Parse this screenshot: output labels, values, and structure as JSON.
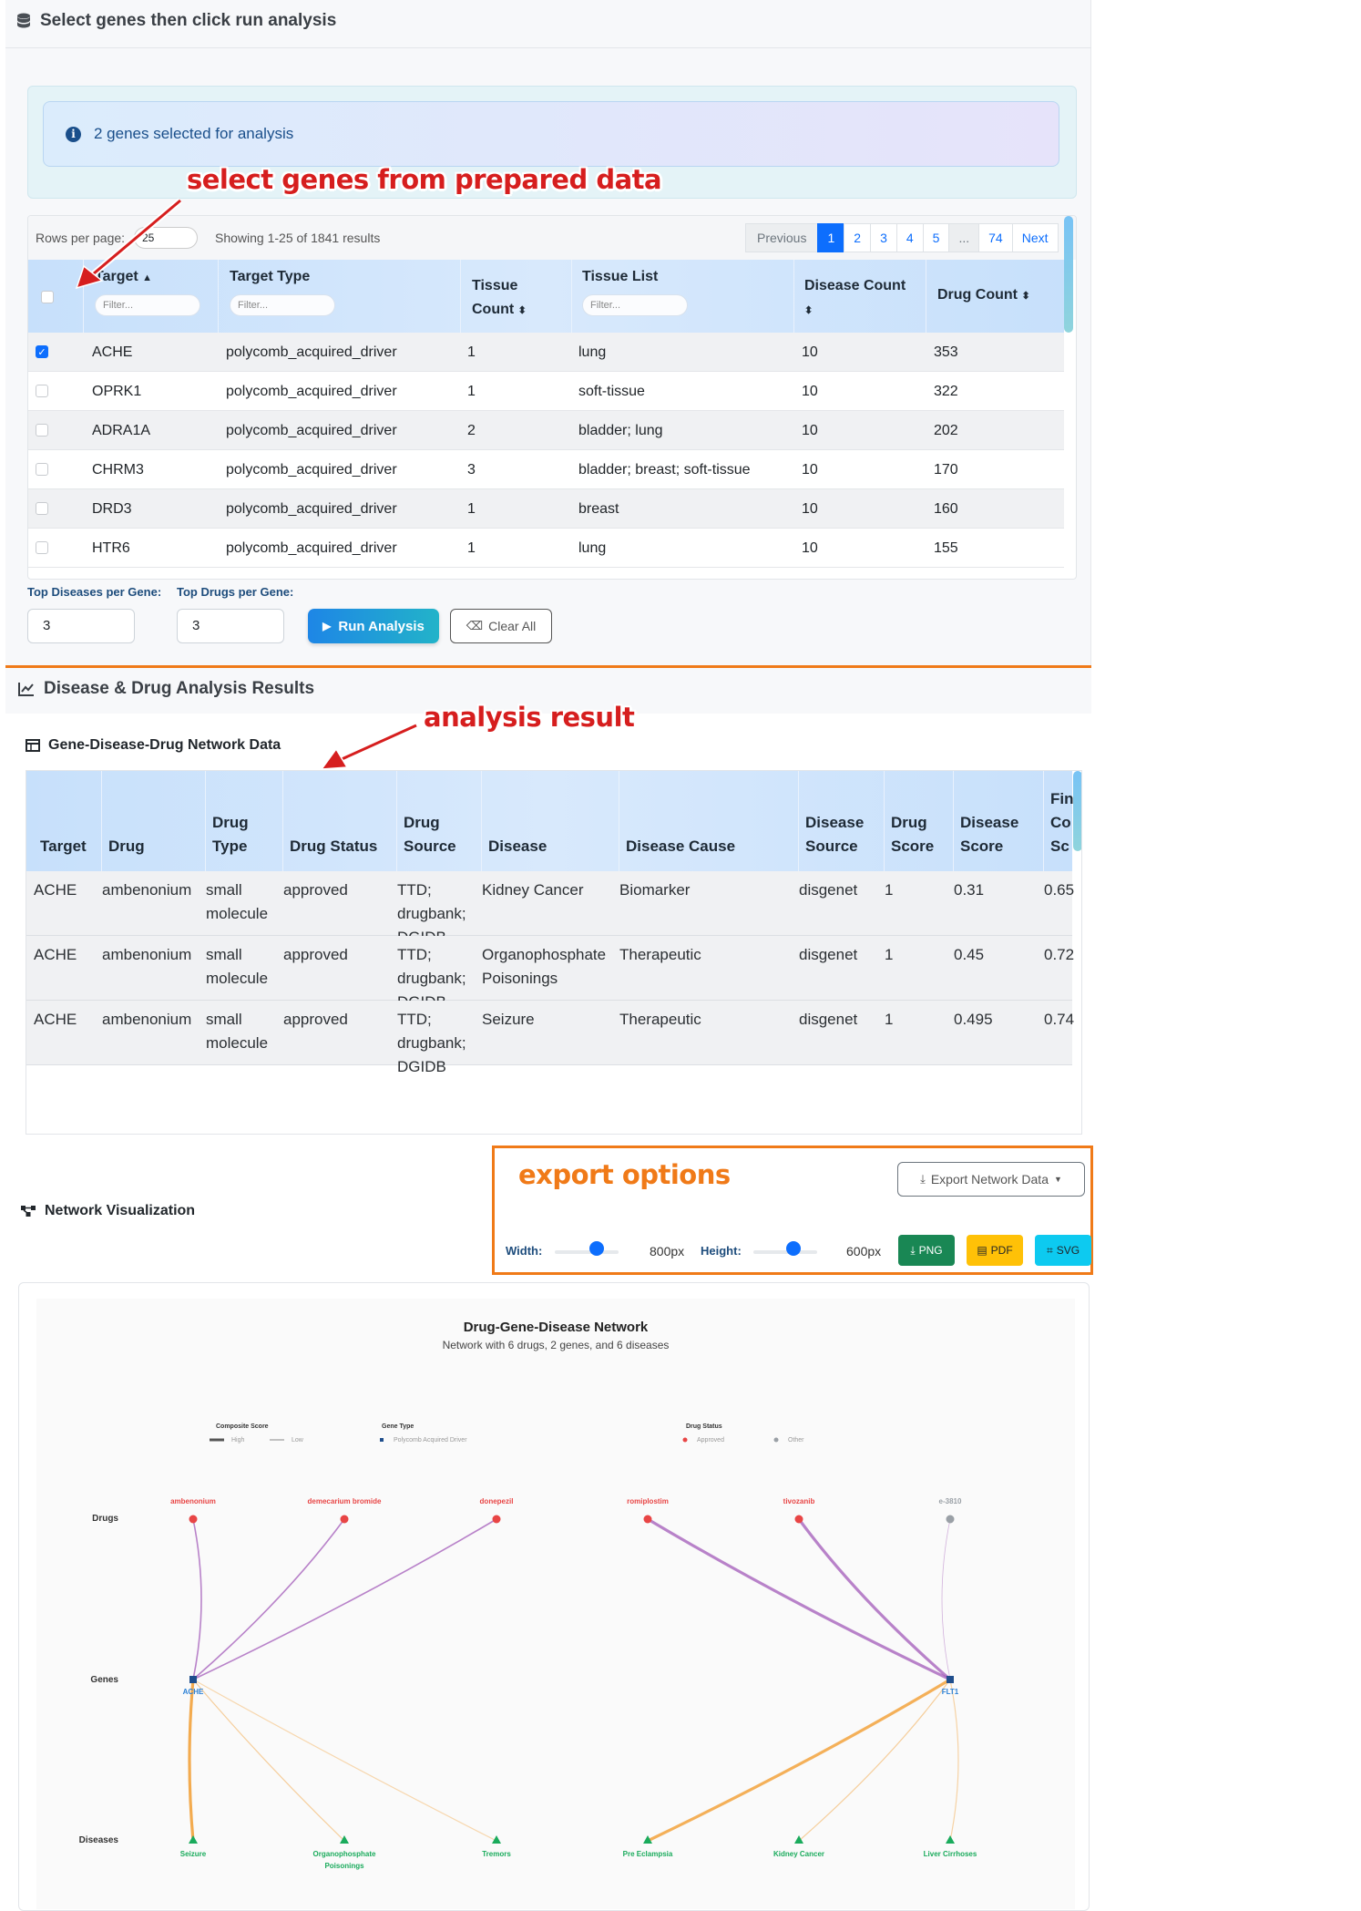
{
  "selection_panel": {
    "title": "Select genes then click run analysis",
    "info_text": "2 genes selected for analysis",
    "annotation": "select genes from prepared data"
  },
  "targets_table": {
    "rows_per_page_label": "Rows per page:",
    "rows_per_page_value": "25",
    "showing_text": "Showing 1-25 of 1841 results",
    "pagination": [
      "Previous",
      "1",
      "2",
      "3",
      "4",
      "5",
      "...",
      "74",
      "Next"
    ],
    "active_page": "1",
    "headers": {
      "target": "Target",
      "target_type": "Target Type",
      "tissue_count_1": "Tissue",
      "tissue_count_2": "Count",
      "tissue_list": "Tissue List",
      "disease_count": "Disease Count",
      "drug_count": "Drug Count"
    },
    "filter_placeholder": "Filter...",
    "rows": [
      {
        "checked": true,
        "target": "ACHE",
        "target_type": "polycomb_acquired_driver",
        "tissue_count": "1",
        "tissue_list": "lung",
        "disease_count": "10",
        "drug_count": "353"
      },
      {
        "checked": false,
        "target": "OPRK1",
        "target_type": "polycomb_acquired_driver",
        "tissue_count": "1",
        "tissue_list": "soft-tissue",
        "disease_count": "10",
        "drug_count": "322"
      },
      {
        "checked": false,
        "target": "ADRA1A",
        "target_type": "polycomb_acquired_driver",
        "tissue_count": "2",
        "tissue_list": "bladder; lung",
        "disease_count": "10",
        "drug_count": "202"
      },
      {
        "checked": false,
        "target": "CHRM3",
        "target_type": "polycomb_acquired_driver",
        "tissue_count": "3",
        "tissue_list": "bladder; breast; soft-tissue",
        "disease_count": "10",
        "drug_count": "170"
      },
      {
        "checked": false,
        "target": "DRD3",
        "target_type": "polycomb_acquired_driver",
        "tissue_count": "1",
        "tissue_list": "breast",
        "disease_count": "10",
        "drug_count": "160"
      },
      {
        "checked": false,
        "target": "HTR6",
        "target_type": "polycomb_acquired_driver",
        "tissue_count": "1",
        "tissue_list": "lung",
        "disease_count": "10",
        "drug_count": "155"
      }
    ]
  },
  "controls": {
    "top_diseases_label": "Top Diseases per Gene:",
    "top_diseases_value": "3",
    "top_drugs_label": "Top Drugs per Gene:",
    "top_drugs_value": "3",
    "run_label": "Run Analysis",
    "clear_label": "Clear All"
  },
  "results": {
    "title": "Disease & Drug Analysis Results",
    "annotation": "analysis result",
    "network_data_title": "Gene-Disease-Drug Network Data",
    "headers": [
      [
        "Target"
      ],
      [
        "Drug"
      ],
      [
        "Drug",
        "Type"
      ],
      [
        "Drug Status"
      ],
      [
        "Drug",
        "Source"
      ],
      [
        "Disease"
      ],
      [
        "Disease Cause"
      ],
      [
        "Disease",
        "Source"
      ],
      [
        "Drug",
        "Score"
      ],
      [
        "Disease",
        "Score"
      ],
      [
        "Fin",
        "Co",
        "Sc"
      ]
    ],
    "rows": [
      {
        "target": "ACHE",
        "drug": "ambenonium",
        "drug_type": [
          "small",
          "molecule"
        ],
        "drug_status": "approved",
        "drug_source": [
          "TTD;",
          "drugbank;",
          "DGIDB"
        ],
        "disease": [
          "Kidney Cancer"
        ],
        "disease_cause": "Biomarker",
        "disease_source": "disgenet",
        "drug_score": "1",
        "disease_score": "0.31",
        "final": "0.65"
      },
      {
        "target": "ACHE",
        "drug": "ambenonium",
        "drug_type": [
          "small",
          "molecule"
        ],
        "drug_status": "approved",
        "drug_source": [
          "TTD;",
          "drugbank;",
          "DGIDB"
        ],
        "disease": [
          "Organophosphate",
          "Poisonings"
        ],
        "disease_cause": "Therapeutic",
        "disease_source": "disgenet",
        "drug_score": "1",
        "disease_score": "0.45",
        "final": "0.72"
      },
      {
        "target": "ACHE",
        "drug": "ambenonium",
        "drug_type": [
          "small",
          "molecule"
        ],
        "drug_status": "approved",
        "drug_source": [
          "TTD;",
          "drugbank;",
          "DGIDB"
        ],
        "disease": [
          "Seizure"
        ],
        "disease_cause": "Therapeutic",
        "disease_source": "disgenet",
        "drug_score": "1",
        "disease_score": "0.495",
        "final": "0.74"
      }
    ]
  },
  "export": {
    "annotation": "export options",
    "export_button": "Export Network Data",
    "width_label": "Width:",
    "width_value": "800px",
    "height_label": "Height:",
    "height_value": "600px",
    "png": "PNG",
    "pdf": "PDF",
    "svg": "SVG",
    "colors": {
      "png": "#198754",
      "pdf": "#ffc107",
      "svg": "#0dcaf0"
    }
  },
  "network": {
    "section_title": "Network Visualization",
    "title": "Drug-Gene-Disease Network",
    "subtitle": "Network with 6 drugs, 2 genes, and 6 diseases",
    "legend": {
      "composite_title": "Composite Score",
      "high": "High",
      "low": "Low",
      "gene_type_title": "Gene Type",
      "gene_type_item": "Polycomb Acquired Driver",
      "drug_status_title": "Drug Status",
      "approved": "Approved",
      "other": "Other"
    },
    "row_labels": {
      "drugs": "Drugs",
      "genes": "Genes",
      "diseases": "Diseases"
    },
    "drugs": [
      {
        "name": "ambenonium",
        "status": "approved"
      },
      {
        "name": "demecarium bromide",
        "status": "approved"
      },
      {
        "name": "donepezil",
        "status": "approved"
      },
      {
        "name": "romiplostim",
        "status": "approved"
      },
      {
        "name": "tivozanib",
        "status": "approved"
      },
      {
        "name": "e-3810",
        "status": "other"
      }
    ],
    "genes": [
      {
        "name": "ACHE"
      },
      {
        "name": "FLT1"
      }
    ],
    "diseases": [
      {
        "name": [
          "Seizure"
        ]
      },
      {
        "name": [
          "Organophosphate",
          "Poisonings"
        ]
      },
      {
        "name": [
          "Tremors"
        ]
      },
      {
        "name": [
          "Pre Eclampsia"
        ]
      },
      {
        "name": [
          "Kidney Cancer"
        ]
      },
      {
        "name": [
          "Liver Cirrhoses"
        ]
      }
    ],
    "colors": {
      "approved": "#e84545",
      "other": "#9aa0a6",
      "gene": "#1f4e8c",
      "gene_label": "#2a7fd4",
      "disease": "#1aab5c",
      "drug_edge": "#a25ab8",
      "disease_edge": "#f2a23c"
    }
  }
}
